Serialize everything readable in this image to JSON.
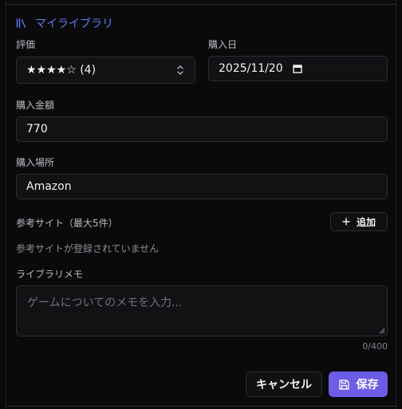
{
  "section": {
    "title": "マイライブラリ",
    "icon": "library-icon",
    "accent": "#5b7cf2"
  },
  "rating": {
    "label": "評価",
    "value": "★★★★☆ (4)"
  },
  "purchase_date": {
    "label": "購入日",
    "value": "2025/11/20"
  },
  "purchase_amount": {
    "label": "購入金額",
    "value": "770"
  },
  "purchase_place": {
    "label": "購入場所",
    "value": "Amazon"
  },
  "reference_sites": {
    "label": "参考サイト（最大5件）",
    "add_label": "追加",
    "empty_text": "参考サイトが登録されていません"
  },
  "memo": {
    "label": "ライブラリメモ",
    "placeholder": "ゲームについてのメモを入力...",
    "counter": "0/400"
  },
  "actions": {
    "cancel_label": "キャンセル",
    "save_label": "保存",
    "save_color": "#6d5ce6"
  }
}
